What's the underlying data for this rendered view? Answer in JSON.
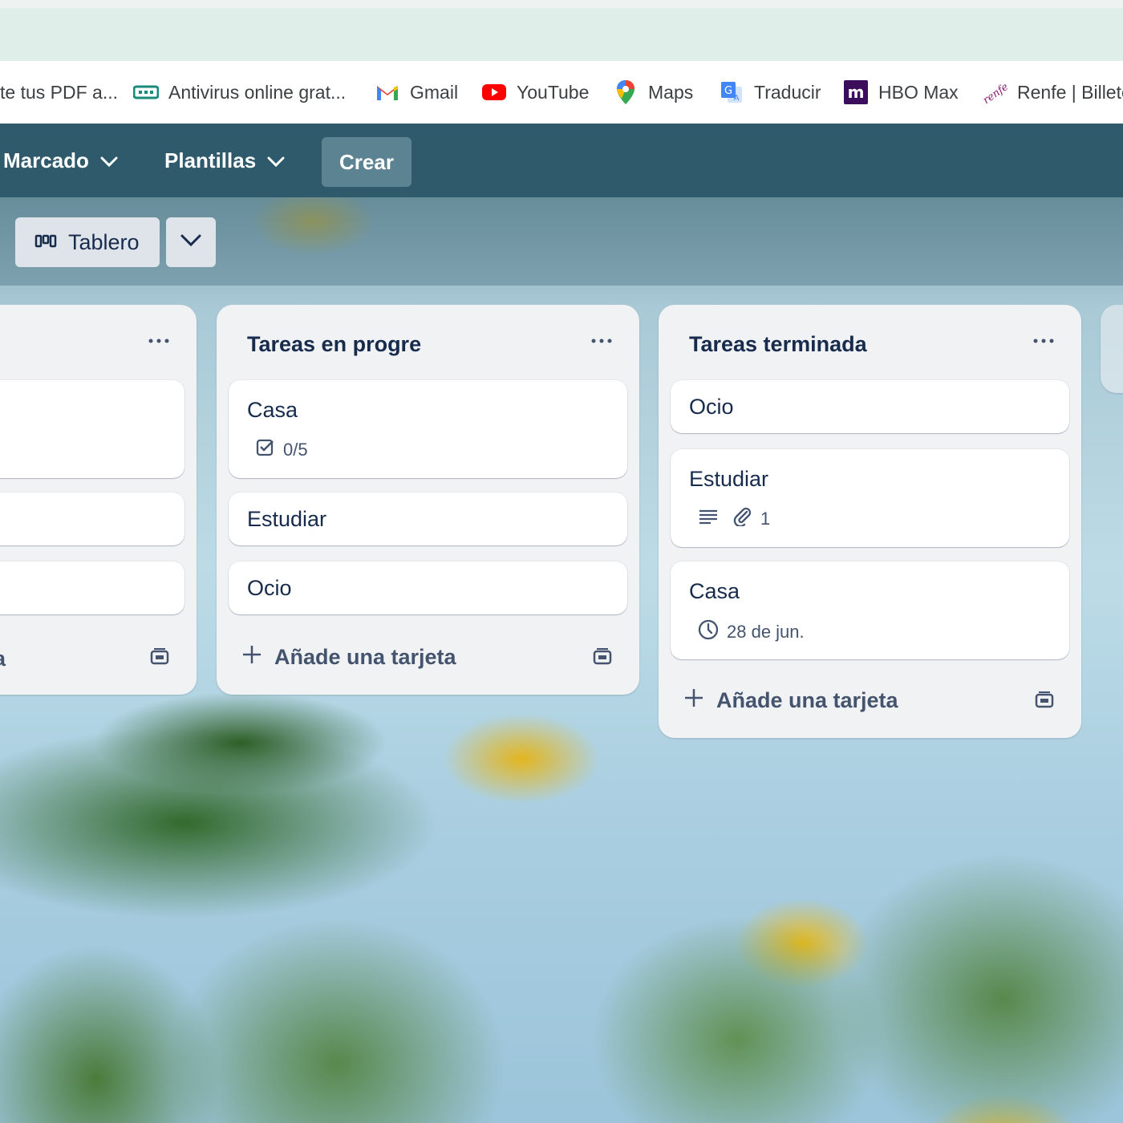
{
  "browser": {
    "bookmarks": [
      {
        "label": "te tus PDF a...",
        "icon": "pdf-icon"
      },
      {
        "label": "Antivirus online grat...",
        "icon": "antivirus-icon"
      },
      {
        "label": "Gmail",
        "icon": "gmail-icon"
      },
      {
        "label": "YouTube",
        "icon": "youtube-icon"
      },
      {
        "label": "Maps",
        "icon": "maps-icon"
      },
      {
        "label": "Traducir",
        "icon": "translate-icon"
      },
      {
        "label": "HBO Max",
        "icon": "hbo-max-icon"
      },
      {
        "label": "Renfe | Billete",
        "icon": "renfe-icon"
      }
    ]
  },
  "header": {
    "starred": "Marcado",
    "templates": "Plantillas",
    "create": "Crear",
    "color": "#2e5a6b"
  },
  "board": {
    "view_label": "Tablero",
    "view_icon": "board-icon",
    "lists": [
      {
        "title": "",
        "add_card": "a"
      },
      {
        "title": "Tareas en progre",
        "cards": [
          {
            "title": "Casa",
            "checklist": "0/5"
          },
          {
            "title": "Estudiar"
          },
          {
            "title": "Ocio"
          }
        ],
        "add_card": "Añade una tarjeta"
      },
      {
        "title": "Tareas terminada",
        "cards": [
          {
            "title": "Ocio"
          },
          {
            "title": "Estudiar",
            "attachments": "1"
          },
          {
            "title": "Casa",
            "due": "28 de jun."
          }
        ],
        "add_card": "Añade una tarjeta"
      }
    ]
  }
}
